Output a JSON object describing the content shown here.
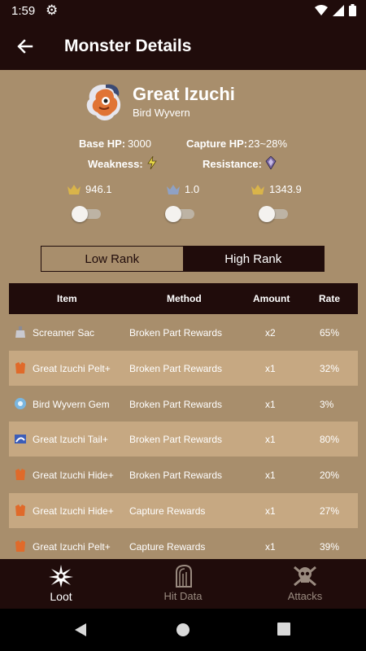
{
  "status": {
    "time": "1:59"
  },
  "app_bar": {
    "title": "Monster Details"
  },
  "monster": {
    "name": "Great Izuchi",
    "type": "Bird Wyvern",
    "base_hp_label": "Base HP:",
    "base_hp": "3000",
    "capture_hp_label": "Capture HP:",
    "capture_hp": "23~28%",
    "weakness_label": "Weakness:",
    "resistance_label": "Resistance:"
  },
  "crowns": [
    {
      "icon": "gold-crown-icon",
      "value": "946.1",
      "color": "#d9b44a"
    },
    {
      "icon": "silver-crown-icon",
      "value": "1.0",
      "color": "#8fa1c4"
    },
    {
      "icon": "gold-crown-icon",
      "value": "1343.9",
      "color": "#d9b44a"
    }
  ],
  "rank_tabs": {
    "low": "Low Rank",
    "high": "High Rank",
    "selected": "High Rank"
  },
  "table": {
    "headers": {
      "item": "Item",
      "method": "Method",
      "amount": "Amount",
      "rate": "Rate"
    },
    "rows": [
      {
        "icon": "sac-icon",
        "item": "Screamer Sac",
        "method": "Broken Part Rewards",
        "amount": "x2",
        "rate": "65%"
      },
      {
        "icon": "pelt-icon",
        "item": "Great Izuchi Pelt+",
        "method": "Broken Part Rewards",
        "amount": "x1",
        "rate": "32%"
      },
      {
        "icon": "gem-icon",
        "item": "Bird Wyvern Gem",
        "method": "Broken Part Rewards",
        "amount": "x1",
        "rate": "3%"
      },
      {
        "icon": "tail-icon",
        "item": "Great Izuchi Tail+",
        "method": "Broken Part Rewards",
        "amount": "x1",
        "rate": "80%"
      },
      {
        "icon": "hide-icon",
        "item": "Great Izuchi Hide+",
        "method": "Broken Part Rewards",
        "amount": "x1",
        "rate": "20%"
      },
      {
        "icon": "hide-icon",
        "item": "Great Izuchi Hide+",
        "method": "Capture Rewards",
        "amount": "x1",
        "rate": "27%"
      },
      {
        "icon": "pelt-icon",
        "item": "Great Izuchi Pelt+",
        "method": "Capture Rewards",
        "amount": "x1",
        "rate": "39%"
      }
    ]
  },
  "bottom_nav": [
    {
      "label": "Loot",
      "icon": "loot-icon",
      "active": true
    },
    {
      "label": "Hit Data",
      "icon": "hit-data-icon",
      "active": false
    },
    {
      "label": "Attacks",
      "icon": "skull-crossbones-icon",
      "active": false
    }
  ],
  "colors": {
    "dark": "#200c0b",
    "background": "#a88e6c",
    "row_alt": "#c6a882",
    "inactive_nav": "#9a8b80"
  }
}
